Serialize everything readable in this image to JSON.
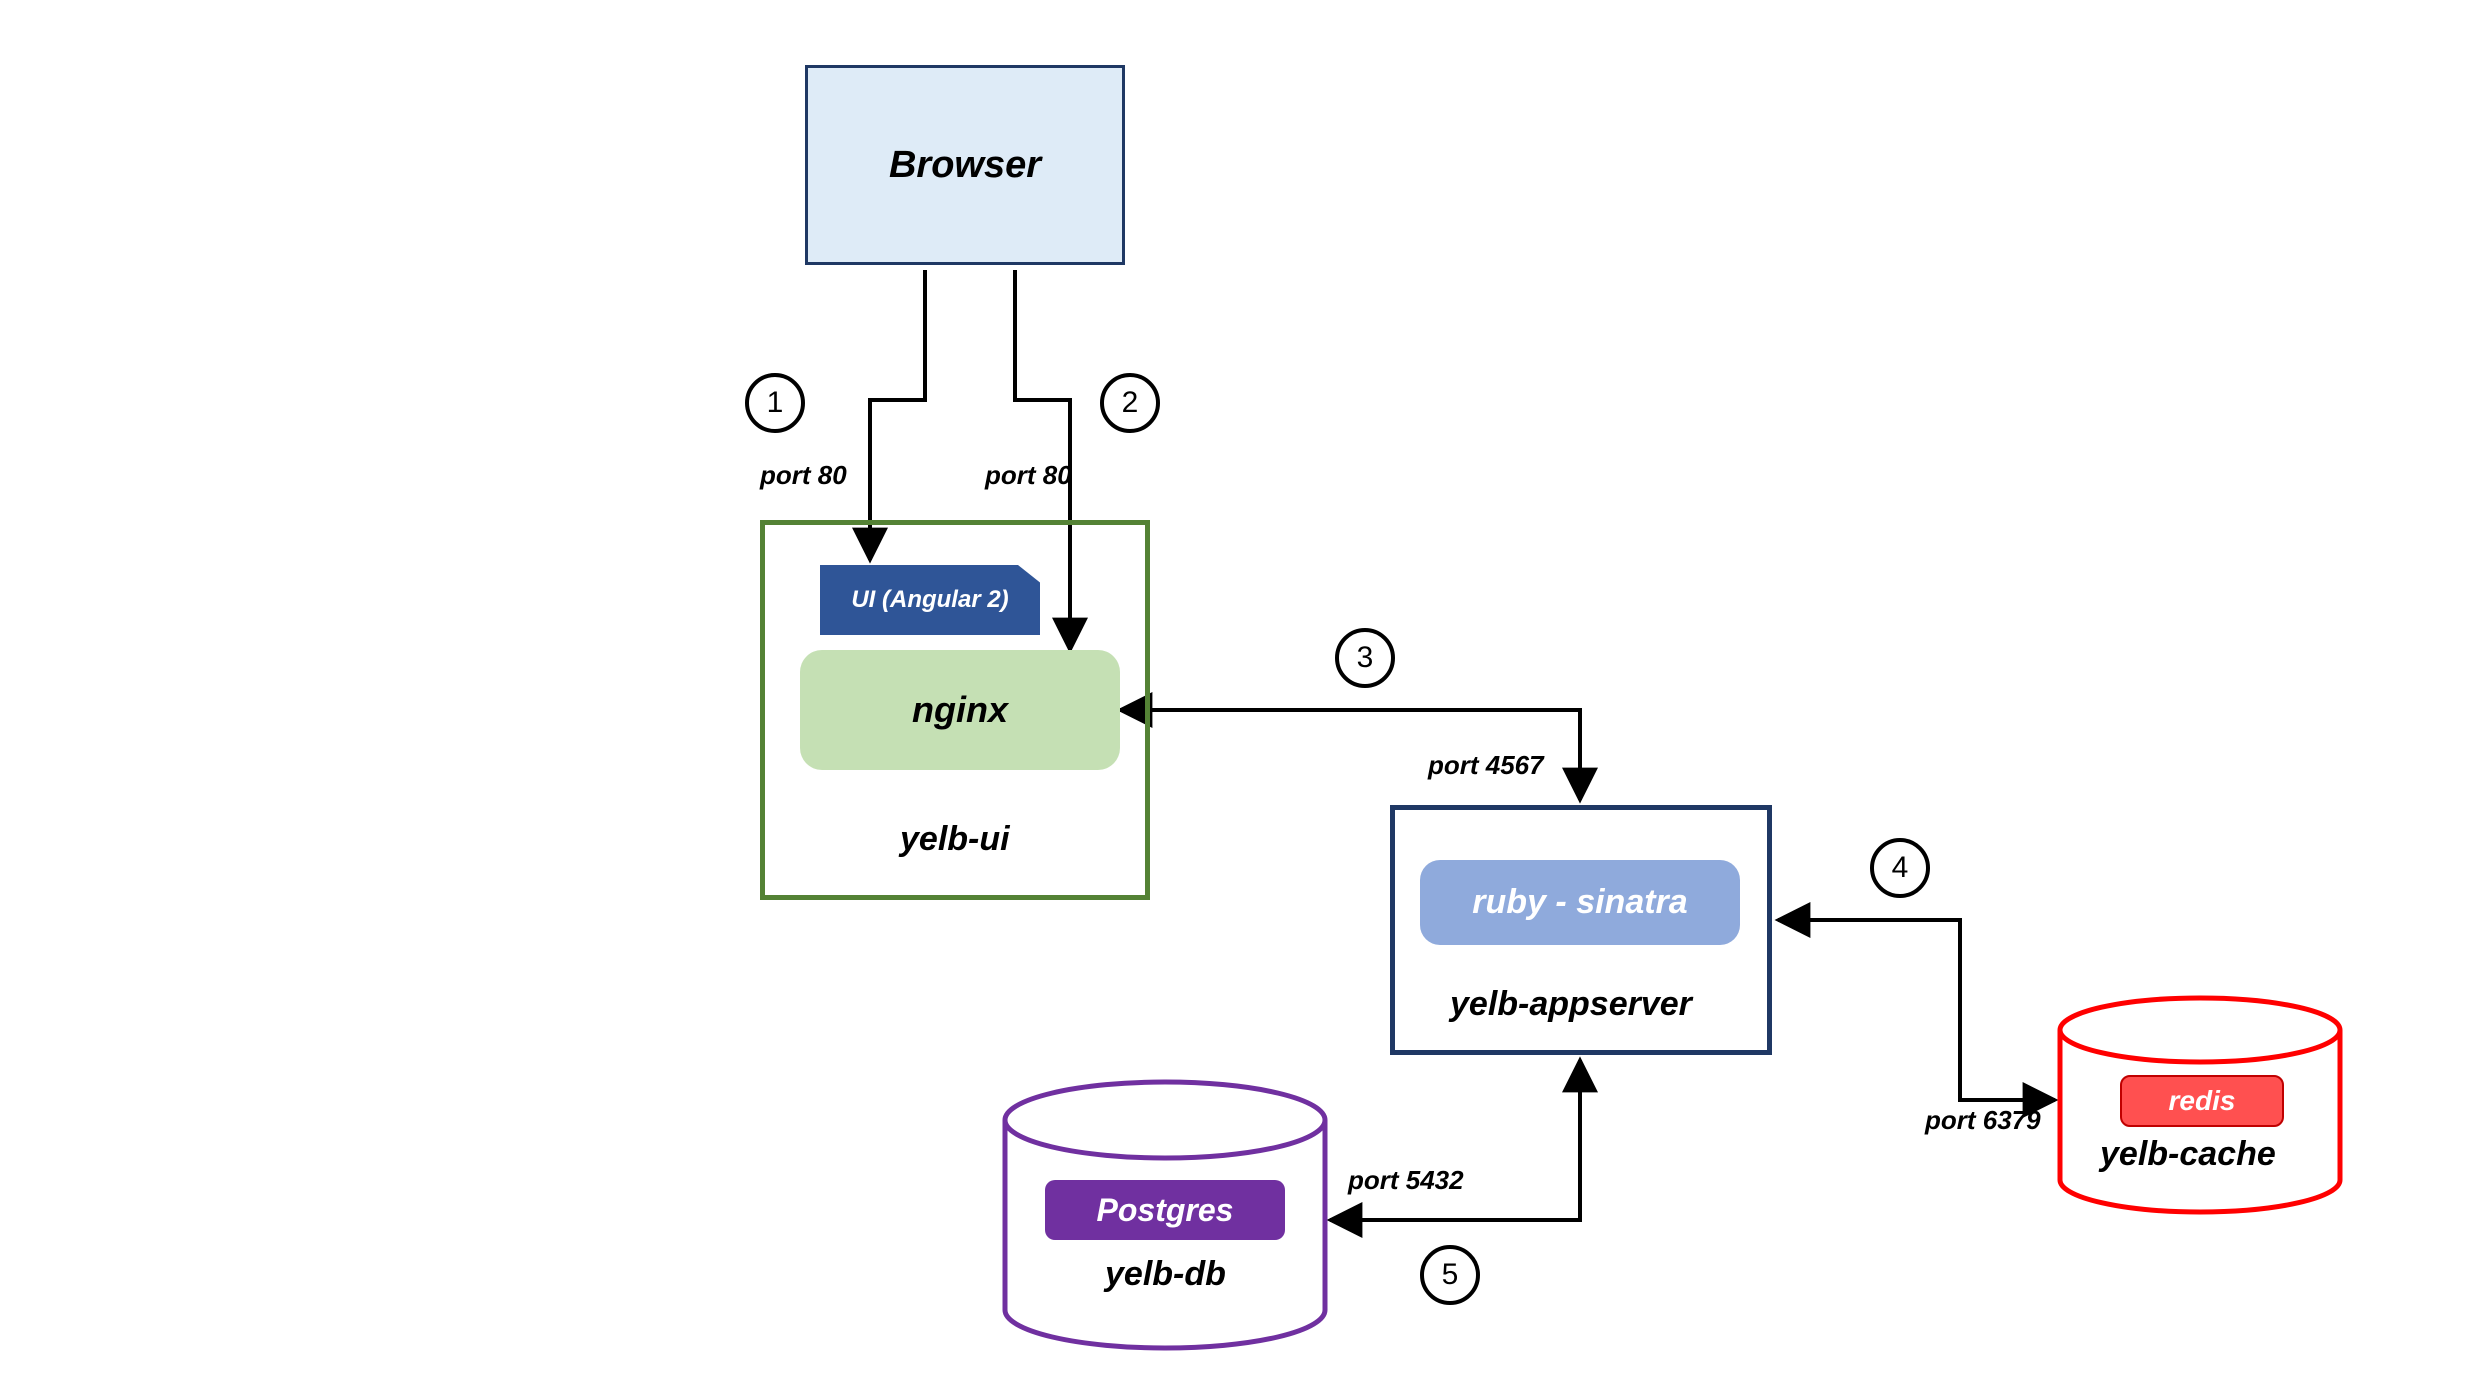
{
  "nodes": {
    "browser": "Browser",
    "yelb_ui": "yelb-ui",
    "angular": "UI (Angular 2)",
    "nginx": "nginx",
    "yelb_appserver": "yelb-appserver",
    "ruby": "ruby - sinatra",
    "postgres": "Postgres",
    "yelb_db": "yelb-db",
    "redis": "redis",
    "yelb_cache": "yelb-cache"
  },
  "ports": {
    "p1": "port 80",
    "p2": "port 80",
    "p3": "port 4567",
    "p4": "port 6379",
    "p5": "port 5432"
  },
  "steps": {
    "s1": "1",
    "s2": "2",
    "s3": "3",
    "s4": "4",
    "s5": "5"
  },
  "chart_data": {
    "type": "diagram",
    "description": "Architecture diagram showing request flow between Browser, yelb-ui (nginx + Angular 2), yelb-appserver (ruby/sinatra), yelb-db (Postgres) and yelb-cache (redis).",
    "components": [
      {
        "id": "browser",
        "label": "Browser",
        "kind": "client"
      },
      {
        "id": "yelb-ui",
        "label": "yelb-ui",
        "kind": "service",
        "subcomponents": [
          "UI (Angular 2)",
          "nginx"
        ]
      },
      {
        "id": "yelb-appserver",
        "label": "yelb-appserver",
        "kind": "service",
        "subcomponents": [
          "ruby - sinatra"
        ]
      },
      {
        "id": "yelb-db",
        "label": "yelb-db",
        "kind": "datastore",
        "engine": "Postgres"
      },
      {
        "id": "yelb-cache",
        "label": "yelb-cache",
        "kind": "datastore",
        "engine": "redis"
      }
    ],
    "edges": [
      {
        "step": 1,
        "from": "browser",
        "to": "yelb-ui",
        "port": 80,
        "note": "Angular UI served"
      },
      {
        "step": 2,
        "from": "browser",
        "to": "yelb-ui",
        "port": 80,
        "note": "proxied to nginx"
      },
      {
        "step": 3,
        "from": "yelb-ui",
        "to": "yelb-appserver",
        "port": 4567
      },
      {
        "step": 4,
        "from": "yelb-appserver",
        "to": "yelb-cache",
        "port": 6379
      },
      {
        "step": 5,
        "from": "yelb-appserver",
        "to": "yelb-db",
        "port": 5432
      }
    ]
  }
}
